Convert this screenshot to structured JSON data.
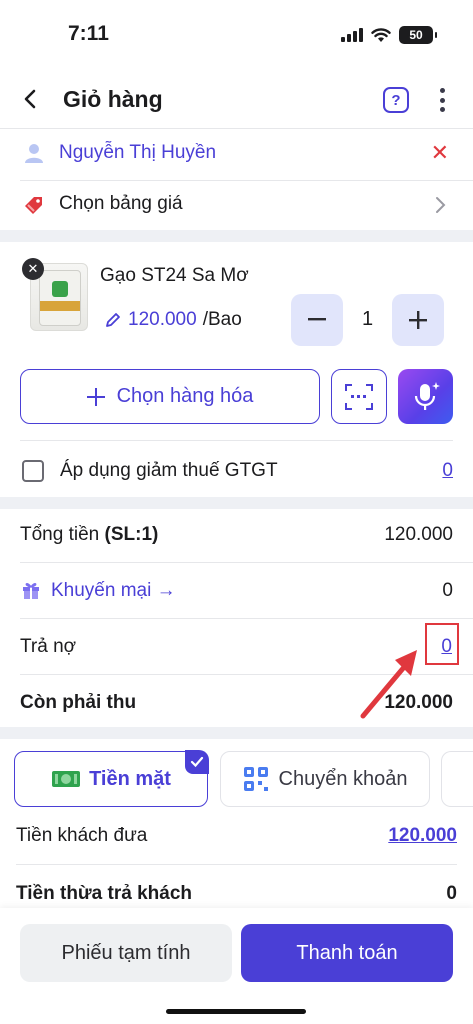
{
  "status_bar": {
    "time": "7:11",
    "battery": "50"
  },
  "header": {
    "title": "Giỏ hàng",
    "help_label": "?"
  },
  "customer": {
    "name": "Nguyễn Thị Huyền"
  },
  "price_list": {
    "label": "Chọn bảng giá"
  },
  "product": {
    "name": "Gạo ST24 Sa Mơ",
    "price": "120.000",
    "unit": "/Bao",
    "quantity": "1",
    "thumb_text": "SA MƠ"
  },
  "actions": {
    "choose_goods_label": "Chọn hàng hóa"
  },
  "vat": {
    "label": "Áp dụng giảm thuế GTGT",
    "value": "0",
    "checked": false
  },
  "summary": {
    "total_label": "Tổng tiền",
    "total_qty": "(SL:1)",
    "total_value": "120.000",
    "promo_label": "Khuyến mại →",
    "promo_value": "0",
    "debt_label": "Trả nợ",
    "debt_value": "0",
    "due_label": "Còn phải thu",
    "due_value": "120.000"
  },
  "payment": {
    "cash_label": "Tiền mặt",
    "transfer_label": "Chuyển khoản",
    "selected": "cash"
  },
  "given": {
    "label": "Tiền khách đưa",
    "value": "120.000"
  },
  "change": {
    "label": "Tiền thừa trả khách",
    "value": "0"
  },
  "footer": {
    "draft_label": "Phiếu tạm tính",
    "pay_label": "Thanh toán"
  },
  "colors": {
    "accent": "#4a3fd6",
    "danger": "#e0383e",
    "accent_light": "#e1e5fb"
  }
}
